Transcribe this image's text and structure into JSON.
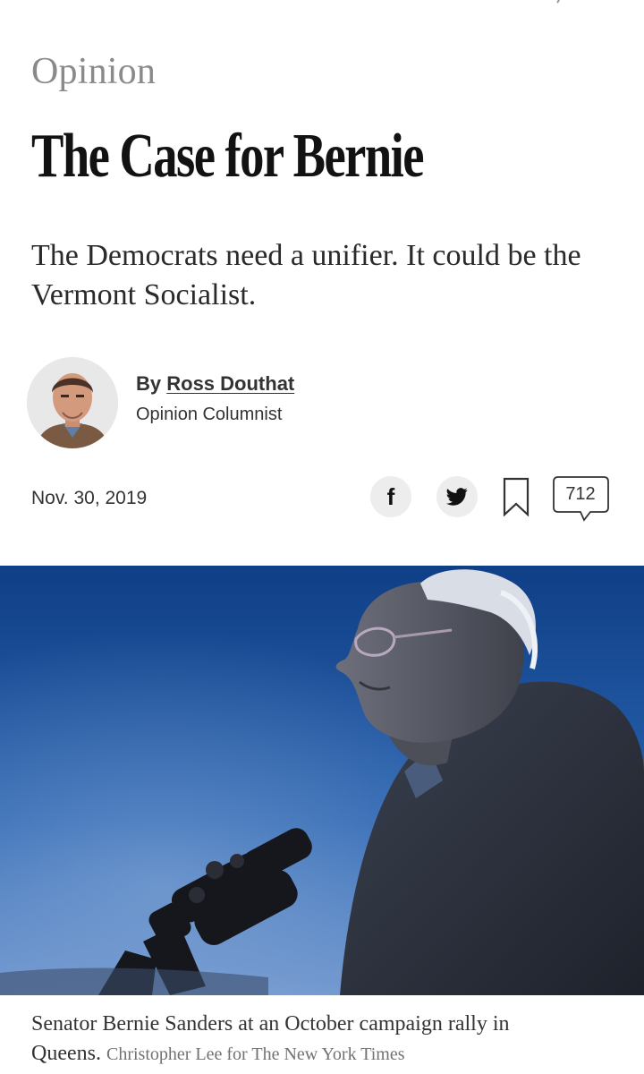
{
  "article": {
    "section": "Opinion",
    "headline": "The Case for Bernie",
    "summary": "The Democrats need a unifier. It could be the Vermont Socialist.",
    "byline_prefix": "By ",
    "author": "Ross Douthat",
    "author_role": "Opinion Columnist",
    "date": "Nov. 30, 2019",
    "comment_count": "712"
  },
  "share": {
    "facebook_glyph": "f"
  },
  "image": {
    "caption": "Senator Bernie Sanders at an October campaign rally in Queens.",
    "credit": "Christopher Lee for The New York Times"
  },
  "icons": [
    "facebook-icon",
    "twitter-icon",
    "bookmark-icon",
    "comment-icon"
  ],
  "colors": {
    "sky_top": "#0f3f86",
    "sky_bottom": "#3d79c4",
    "text": "#121212",
    "muted": "#8a8a8a"
  }
}
